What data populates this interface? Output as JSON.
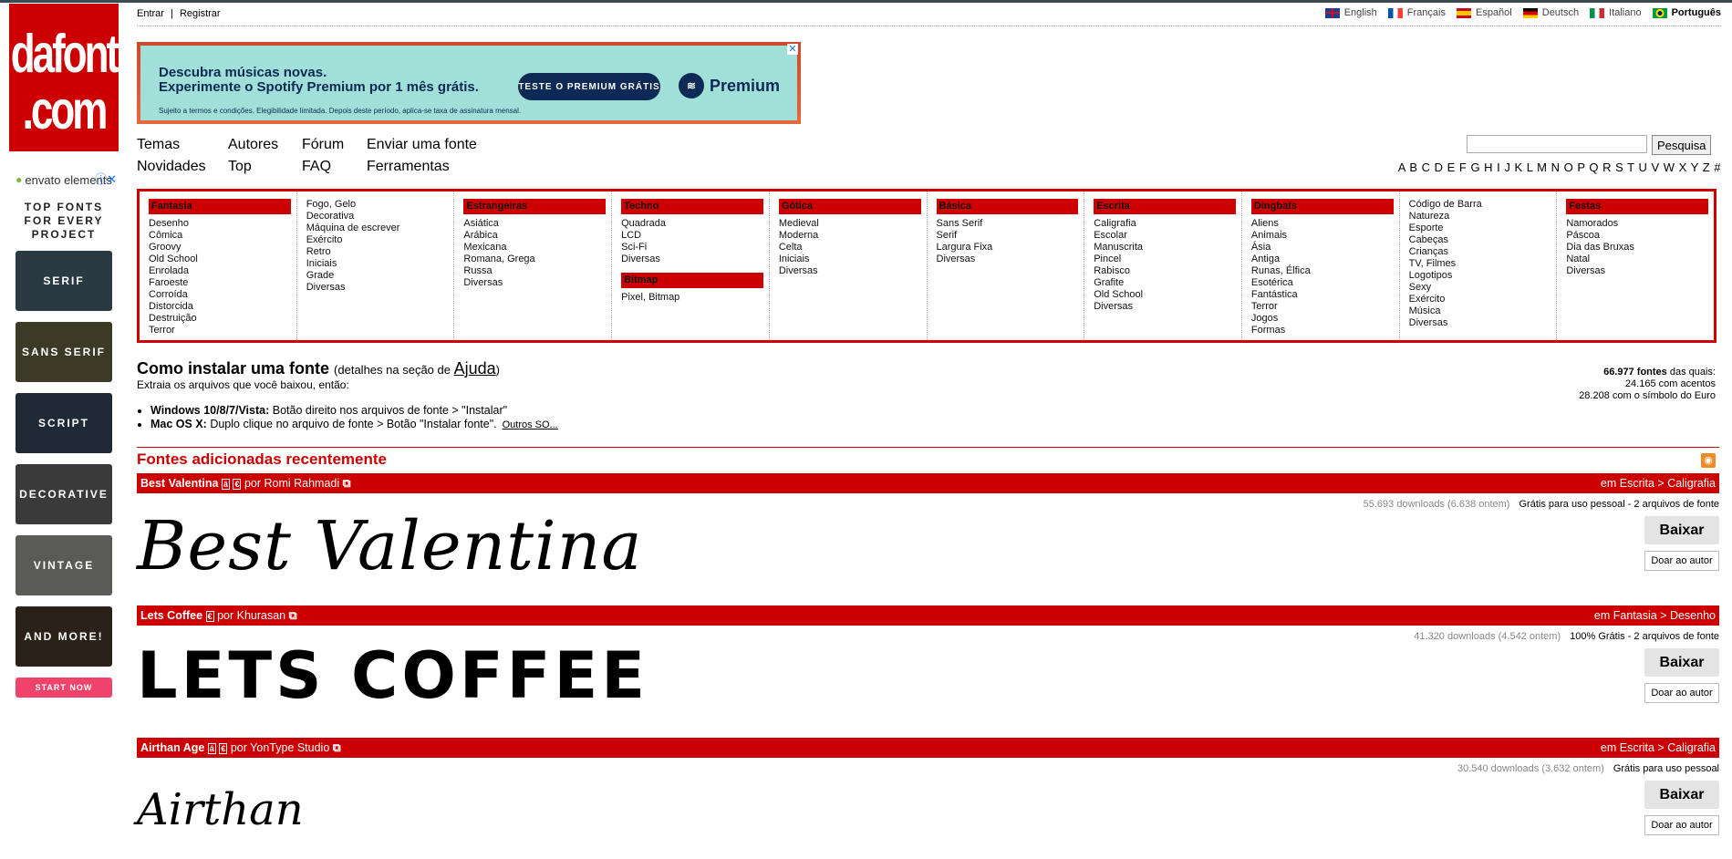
{
  "site": {
    "logo_line1": "dafont",
    "logo_line2": ".com"
  },
  "auth": {
    "login": "Entrar",
    "separator": "|",
    "register": "Registrar"
  },
  "languages": [
    "English",
    "Français",
    "Español",
    "Deutsch",
    "Italiano",
    "Português"
  ],
  "active_language": "Português",
  "side_ad": {
    "brand": "envato elements",
    "headline": "TOP FONTS FOR EVERY PROJECT",
    "tiles": [
      "SERIF",
      "SANS SERIF",
      "SCRIPT",
      "DECORATIVE",
      "VINTAGE",
      "AND MORE!"
    ],
    "cta": "START NOW"
  },
  "banner": {
    "line1": "Descubra músicas novas.",
    "line2": "Experimente o Spotify Premium por 1 mês grátis.",
    "button": "TESTE O PREMIUM GRÁTIS",
    "brand": "Premium",
    "fine_print": "Sujeito a termos e condições. Elegibilidade limitada. Depois deste período, aplica-se taxa de assinatura mensal."
  },
  "nav": {
    "themes": "Temas",
    "authors": "Autores",
    "forum": "Fórum",
    "submit": "Enviar uma fonte",
    "news": "Novidades",
    "top": "Top",
    "faq": "FAQ",
    "tools": "Ferramentas"
  },
  "search": {
    "button": "Pesquisa",
    "value": ""
  },
  "alphabet": "A B C D E F G H I J K L M N O P Q R S T U V W X Y Z #",
  "categories": {
    "fantasia": {
      "title": "Fantasia",
      "items": [
        "Desenho",
        "Cômica",
        "Groovy",
        "Old School",
        "Enrolada",
        "Faroeste",
        "Corroída",
        "Distorcida",
        "Destruição",
        "Terror"
      ]
    },
    "fantasia2": {
      "items": [
        "Fogo, Gelo",
        "Decorativa",
        "Máquina de escrever",
        "Exército",
        "Retro",
        "Iniciais",
        "Grade",
        "Diversas"
      ]
    },
    "estrangeiras": {
      "title": "Estrangeiras",
      "items": [
        "Asiática",
        "Arábica",
        "Mexicana",
        "Romana, Grega",
        "Russa",
        "Diversas"
      ]
    },
    "techno": {
      "title": "Techno",
      "items": [
        "Quadrada",
        "LCD",
        "Sci-Fi",
        "Diversas"
      ]
    },
    "bitmap": {
      "title": "Bitmap",
      "items": [
        "Pixel, Bitmap"
      ]
    },
    "gotica": {
      "title": "Gótica",
      "items": [
        "Medieval",
        "Moderna",
        "Celta",
        "Iniciais",
        "Diversas"
      ]
    },
    "basica": {
      "title": "Básica",
      "items": [
        "Sans Serif",
        "Serif",
        "Largura Fixa",
        "Diversas"
      ]
    },
    "escrita": {
      "title": "Escrita",
      "items": [
        "Caligrafia",
        "Escolar",
        "Manuscrita",
        "Pincel",
        "Rabisco",
        "Grafite",
        "Old School",
        "Diversas"
      ]
    },
    "dingbats": {
      "title": "Dingbats",
      "items": [
        "Aliens",
        "Animais",
        "Ásia",
        "Antiga",
        "Runas, Élfica",
        "Esotérica",
        "Fantástica",
        "Terror",
        "Jogos",
        "Formas"
      ]
    },
    "dingbats2": {
      "items": [
        "Código de Barra",
        "Natureza",
        "Esporte",
        "Cabeças",
        "Crianças",
        "TV, Filmes",
        "Logotipos",
        "Sexy",
        "Exército",
        "Música",
        "Diversas"
      ]
    },
    "festas": {
      "title": "Festas",
      "items": [
        "Namorados",
        "Páscoa",
        "Dia das Bruxas",
        "Natal",
        "Diversas"
      ]
    }
  },
  "install": {
    "heading": "Como instalar uma fonte",
    "details_pre": "(detalhes na seção de ",
    "details_link": "Ajuda",
    "details_post": ")",
    "intro": "Extraia os arquivos que você baixou, então:",
    "win_label": "Windows 10/8/7/Vista:",
    "win_text": "Botão direito nos arquivos de fonte > \"Instalar\"",
    "mac_label": "Mac OS X:",
    "mac_text": "Duplo clique no arquivo de fonte > Botão \"Instalar fonte\".",
    "other": "Outros SO..."
  },
  "stats": {
    "total": "66.977 fontes",
    "total_suffix": "das quais:",
    "accents": "24.165 com acentos",
    "euro": "28.208 com o símbolo do Euro"
  },
  "recent_title": "Fontes adicionadas recentemente",
  "fonts": [
    {
      "name": "Best Valentina",
      "by": "por Romi Rahmadi",
      "category": "em Escrita > Caligrafia",
      "downloads": "55.693 downloads (6.638 ontem)",
      "license": "Grátis para uso pessoal - 2 arquivos de fonte",
      "preview": "Best Valentina",
      "download": "Baixar",
      "donate": "Doar ao autor"
    },
    {
      "name": "Lets Coffee",
      "by": "por Khurasan",
      "category": "em Fantasia > Desenho",
      "downloads": "41.320 downloads (4.542 ontem)",
      "license": "100% Grátis - 2 arquivos de fonte",
      "preview": "LETS COFFEE",
      "download": "Baixar",
      "donate": "Doar ao autor"
    },
    {
      "name": "Airthan Age",
      "by": "por YonType Studio",
      "category": "em Escrita > Caligrafia",
      "downloads": "30.540 downloads (3.632 ontem)",
      "license": "Grátis para uso pessoal",
      "preview": "Airthan",
      "download": "Baixar",
      "donate": "Doar ao autor"
    }
  ]
}
